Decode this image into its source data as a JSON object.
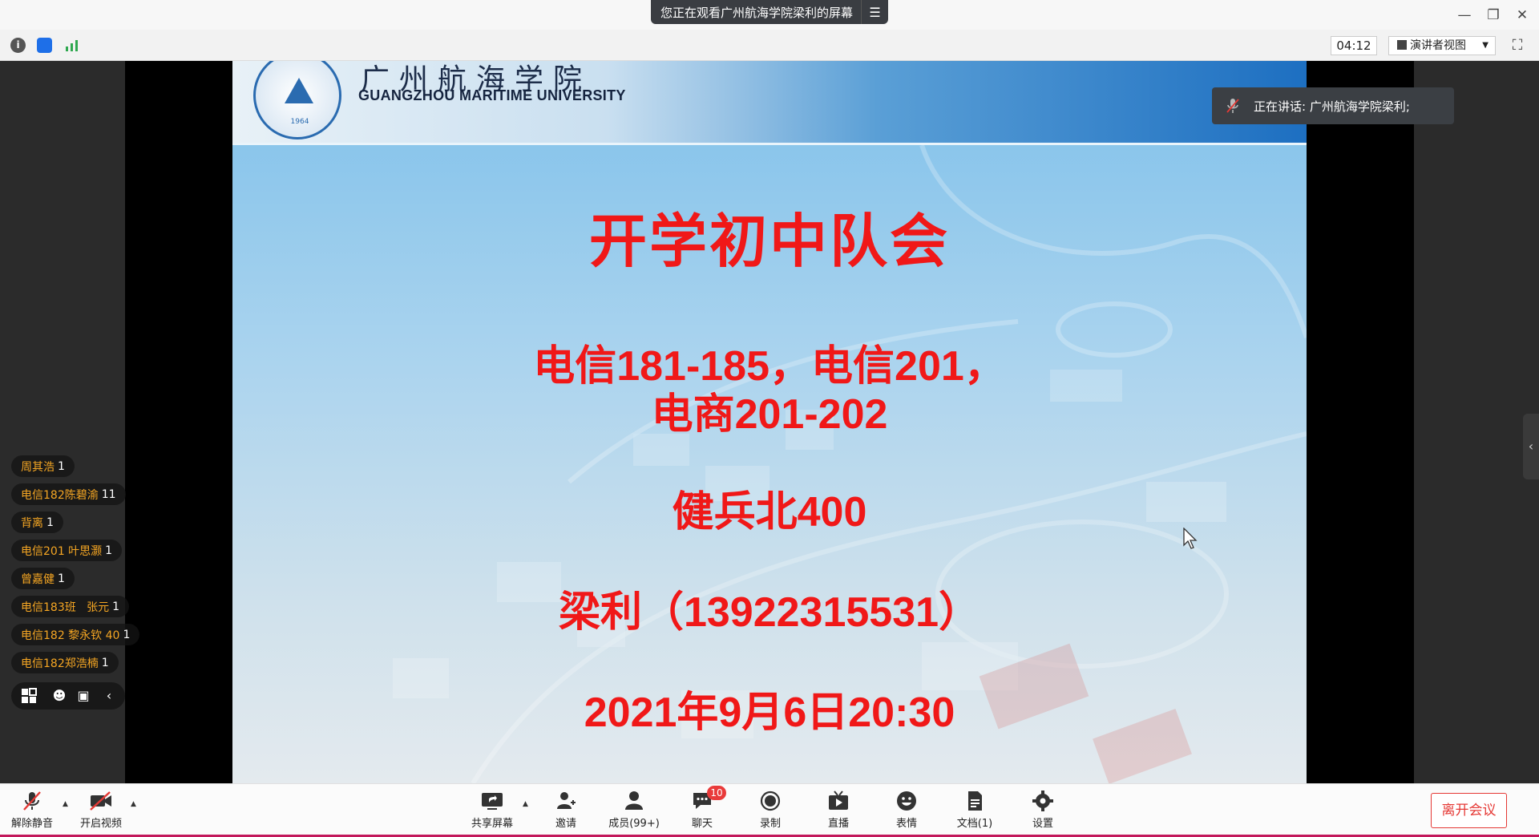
{
  "titlebar": {
    "share_banner": "您正在观看广州航海学院梁利的屏幕",
    "menu_icon": "list-icon",
    "window_controls": [
      "minimize-icon",
      "restore-icon",
      "close-icon"
    ]
  },
  "subbar": {
    "icons": [
      "info-icon",
      "shield-icon",
      "signal-icon"
    ],
    "timer": "04:12",
    "view_mode": "演讲者视图",
    "fullscreen_icon": "fullscreen-icon"
  },
  "slide": {
    "school_cn": "广州航海学院",
    "school_en": "GUANGZHOU MARITIME UNIVERSITY",
    "seal_year": "1964",
    "title": "开学初中队会",
    "line1": "电信181-185，电信201，",
    "line2": "电商201-202",
    "room": "健兵北400",
    "contact": "梁利（13922315531）",
    "datetime": "2021年9月6日20:30"
  },
  "speaking": {
    "text": "正在讲话: 广州航海学院梁利;"
  },
  "chat": {
    "items": [
      {
        "name": "周其浩",
        "msg": "1"
      },
      {
        "name": "电信182陈碧渝",
        "msg": "11"
      },
      {
        "name": "背离",
        "msg": "1"
      },
      {
        "name": "电信201 叶思灏",
        "msg": "1"
      },
      {
        "name": "曾嘉健",
        "msg": "1"
      },
      {
        "name": "电信183班   张元",
        "msg": "1"
      },
      {
        "name": "电信182 黎永钦 40",
        "msg": "1"
      },
      {
        "name": "电信182郑浩楠",
        "msg": "1"
      }
    ],
    "tools": [
      "layout-icon",
      "emoji-icon",
      "message-icon",
      "collapse-icon"
    ]
  },
  "toolbar": {
    "unmute": "解除静音",
    "start_video": "开启视频",
    "share_screen": "共享屏幕",
    "invite": "邀请",
    "members": "成员(99+)",
    "chat": "聊天",
    "chat_badge": "10",
    "record": "录制",
    "live": "直播",
    "reactions": "表情",
    "docs": "文档(1)",
    "settings": "设置",
    "leave": "离开会议"
  },
  "colors": {
    "slide_text": "#f01818",
    "chat_name": "#f5a623",
    "leave_button": "#e53935",
    "badge": "#e93a3a"
  }
}
